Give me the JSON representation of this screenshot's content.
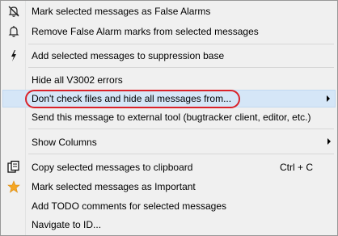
{
  "menu": {
    "items": [
      {
        "label": "Mark selected messages as False Alarms",
        "icon": "bell-off-icon"
      },
      {
        "label": "Remove False Alarm marks from selected messages",
        "icon": "bell-icon"
      },
      {
        "label": "Add selected messages to suppression base",
        "icon": "lightning-icon"
      },
      {
        "label": "Hide all V3002 errors"
      },
      {
        "label": "Don't check files and hide all messages from...",
        "submenu": true,
        "highlighted": true
      },
      {
        "label": "Send this message to external tool (bugtracker client, editor, etc.)"
      },
      {
        "label": "Show Columns",
        "submenu": true
      },
      {
        "label": "Copy selected messages to clipboard",
        "icon": "copy-icon",
        "shortcut": "Ctrl + C"
      },
      {
        "label": "Mark selected messages as Important",
        "icon": "star-icon"
      },
      {
        "label": "Add TODO comments for selected messages"
      },
      {
        "label": "Navigate to ID..."
      }
    ]
  },
  "colors": {
    "highlight": "#d5e6f7",
    "annotation_circle": "#d9222a",
    "star": "#f5a623"
  }
}
